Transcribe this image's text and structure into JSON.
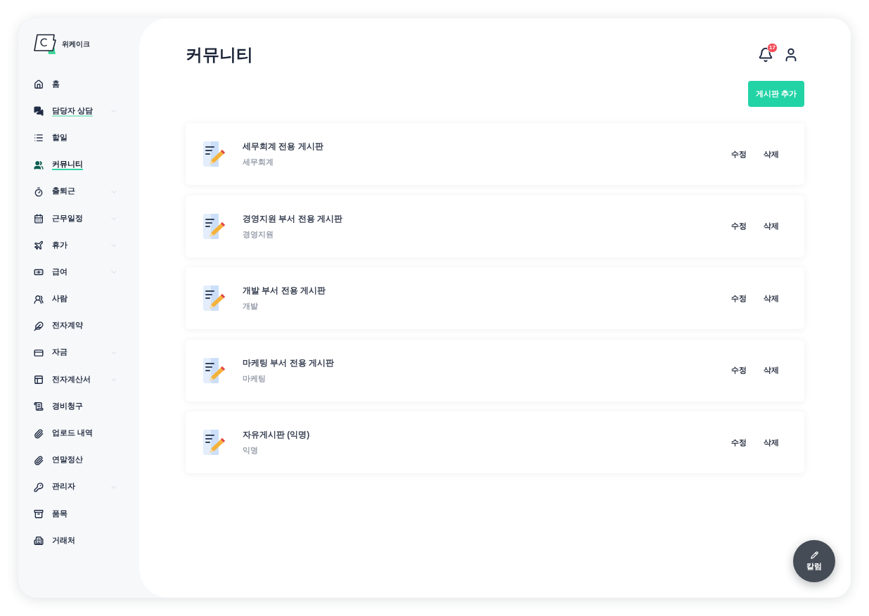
{
  "sidebar": {
    "brand": "위케이크",
    "items": [
      {
        "label": "홈",
        "expandable": false,
        "selected": false,
        "underlined": false
      },
      {
        "label": "담당자 상담",
        "expandable": true,
        "selected": false,
        "underlined": true
      },
      {
        "label": "할일",
        "expandable": false,
        "selected": false,
        "underlined": false
      },
      {
        "label": "커뮤니티",
        "expandable": false,
        "selected": true,
        "underlined": true
      },
      {
        "label": "출퇴근",
        "expandable": true,
        "selected": false,
        "underlined": false
      },
      {
        "label": "근무일정",
        "expandable": true,
        "selected": false,
        "underlined": false
      },
      {
        "label": "휴가",
        "expandable": true,
        "selected": false,
        "underlined": false
      },
      {
        "label": "급여",
        "expandable": true,
        "selected": false,
        "underlined": false
      },
      {
        "label": "사람",
        "expandable": false,
        "selected": false,
        "underlined": false
      },
      {
        "label": "전자계약",
        "expandable": false,
        "selected": false,
        "underlined": false
      },
      {
        "label": "자금",
        "expandable": true,
        "selected": false,
        "underlined": false
      },
      {
        "label": "전자계산서",
        "expandable": true,
        "selected": false,
        "underlined": false
      },
      {
        "label": "경비청구",
        "expandable": false,
        "selected": false,
        "underlined": false
      },
      {
        "label": "업로드 내역",
        "expandable": false,
        "selected": false,
        "underlined": false
      },
      {
        "label": "연말정산",
        "expandable": false,
        "selected": false,
        "underlined": false
      },
      {
        "label": "관리자",
        "expandable": true,
        "selected": false,
        "underlined": false
      },
      {
        "label": "품목",
        "expandable": false,
        "selected": false,
        "underlined": false
      },
      {
        "label": "거래처",
        "expandable": false,
        "selected": false,
        "underlined": false
      }
    ]
  },
  "header": {
    "title": "커뮤니티",
    "notification_count": "17"
  },
  "add_board_button": "게시판 추가",
  "boards": [
    {
      "title": "세무회계 전용 게시판",
      "category": "세무회계",
      "actions": [
        "수정",
        "삭제"
      ]
    },
    {
      "title": "경영지원 부서 전용 게시판",
      "category": "경영지원",
      "actions": [
        "수정",
        "삭제"
      ]
    },
    {
      "title": "개발 부서 전용 게시판",
      "category": "개발",
      "actions": [
        "수정",
        "삭제"
      ]
    },
    {
      "title": "마케팅 부서 전용 게시판",
      "category": "마케팅",
      "actions": [
        "수정",
        "삭제"
      ]
    },
    {
      "title": "자유게시판 (익명)",
      "category": "익명",
      "actions": [
        "수정",
        "삭제"
      ]
    }
  ],
  "fab": {
    "label": "칼럼"
  }
}
